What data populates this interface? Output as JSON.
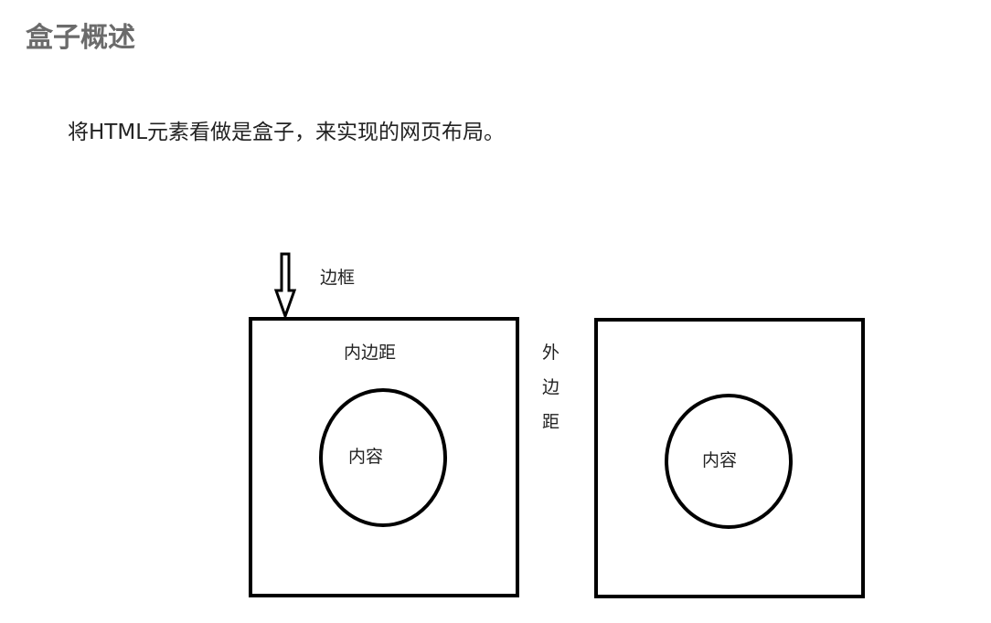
{
  "page": {
    "title": "盒子概述",
    "description": "将HTML元素看做是盒子，来实现的网页布局。"
  },
  "diagram": {
    "border_label": "边框",
    "padding_label": "内边距",
    "margin_label": [
      "外",
      "边",
      "距"
    ],
    "content_label_left": "内容",
    "content_label_right": "内容",
    "stroke_color": "#000000"
  }
}
